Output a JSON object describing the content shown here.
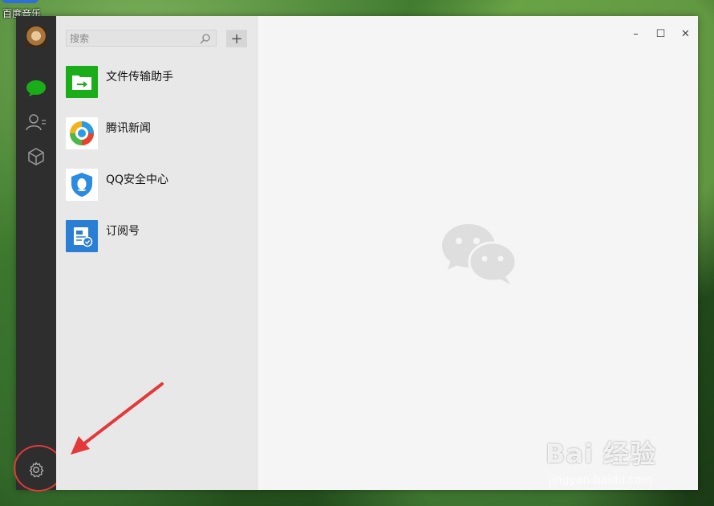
{
  "desktop": {
    "icon_label": "百度音乐"
  },
  "window": {
    "controls": {
      "minimize": "–",
      "maximize": "☐",
      "close": "✕"
    }
  },
  "nav": {
    "items": [
      {
        "name": "chat",
        "icon": "chat-bubble-icon",
        "active": true,
        "color": "#1aad19"
      },
      {
        "name": "contacts",
        "icon": "contacts-icon"
      },
      {
        "name": "favorites",
        "icon": "cube-icon"
      },
      {
        "name": "settings",
        "icon": "gear-icon"
      }
    ]
  },
  "search": {
    "placeholder": "搜索",
    "value": ""
  },
  "add_button": {
    "label": "+"
  },
  "chats": [
    {
      "name": "文件传输助手",
      "icon": "file-transfer-icon",
      "color": "#1aad19"
    },
    {
      "name": "腾讯新闻",
      "icon": "tencent-news-icon",
      "color": "#ffffff"
    },
    {
      "name": "QQ安全中心",
      "icon": "qq-security-icon",
      "color": "#ffffff"
    },
    {
      "name": "订阅号",
      "icon": "subscription-icon",
      "color": "#2a7fd4"
    }
  ],
  "watermark": {
    "brand": "Bai 经验",
    "url": "jingyan.baidu.com"
  },
  "colors": {
    "accent": "#1aad19",
    "annotation": "#e23a3a",
    "rail": "#2e2e2e"
  }
}
